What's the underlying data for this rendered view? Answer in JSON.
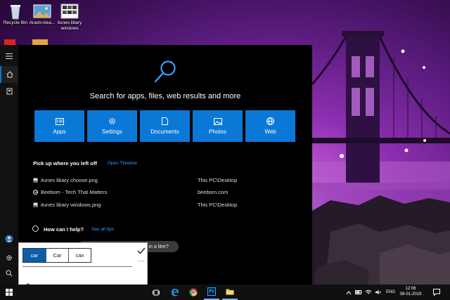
{
  "desktop": {
    "icons": [
      {
        "label": "Recycle Bin",
        "icon": "recycle-bin-icon"
      },
      {
        "label": "Arashi-bea...",
        "icon": "image-file-icon"
      },
      {
        "label": "itunes libary windows",
        "icon": "image-file-icon"
      }
    ]
  },
  "search_panel": {
    "headline": "Search for apps, files, web results and more",
    "categories": [
      {
        "label": "Apps",
        "icon": "apps-icon"
      },
      {
        "label": "Settings",
        "icon": "gear-icon"
      },
      {
        "label": "Documents",
        "icon": "document-icon"
      },
      {
        "label": "Photos",
        "icon": "photo-icon"
      },
      {
        "label": "Web",
        "icon": "globe-icon"
      }
    ],
    "recent": {
      "title": "Pick up where you left off",
      "link": "Open Timeline",
      "items": [
        {
          "name": "itunes libary choose.png",
          "location": "This PC\\Desktop",
          "icon": "image-file-icon"
        },
        {
          "name": "Beebom - Tech That Matters",
          "location": "beebom.com",
          "icon": "edge-icon"
        },
        {
          "name": "itunes libary windows.png",
          "location": "This PC\\Desktop",
          "icon": "image-file-icon"
        }
      ]
    },
    "help": {
      "title": "How can I help?",
      "link": "See all tips",
      "chip_partial": "s in a litre?"
    }
  },
  "handwriting": {
    "candidates": [
      "car",
      "Car",
      "can"
    ],
    "selected_index": 0,
    "more": "...",
    "ink_text": "car"
  },
  "taskbar": {
    "apps": [
      "task-view-icon",
      "edge-icon",
      "chrome-icon",
      "photoshop-icon",
      "file-explorer-icon"
    ],
    "photoshop_label": "Ps",
    "tray": {
      "language": "ENG",
      "time": "12:06",
      "date": "08-01-2019"
    }
  },
  "colors": {
    "accent": "#0a78d7",
    "link": "#3a9df8",
    "panel": "#000000"
  }
}
